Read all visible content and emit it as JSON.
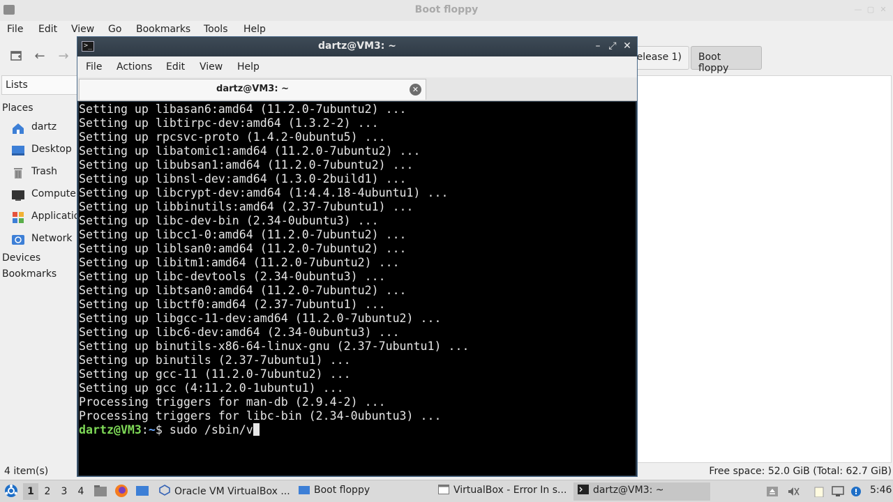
{
  "file_manager": {
    "window_title": "Boot floppy",
    "menu": [
      "File",
      "Edit",
      "View",
      "Go",
      "Bookmarks",
      "Tools",
      "Help"
    ],
    "tabs": [
      {
        "label": "elease 1)"
      },
      {
        "label": "Boot floppy"
      }
    ],
    "sidebar": {
      "lists_label": "Lists",
      "places_label": "Places",
      "items": [
        {
          "label": "dartz",
          "icon": "home-icon"
        },
        {
          "label": "Desktop",
          "icon": "desktop-icon"
        },
        {
          "label": "Trash",
          "icon": "trash-icon"
        },
        {
          "label": "Computer",
          "icon": "computer-icon"
        },
        {
          "label": "Applications",
          "icon": "applications-icon"
        },
        {
          "label": "Network",
          "icon": "network-icon"
        }
      ],
      "devices_label": "Devices",
      "bookmarks_label": "Bookmarks"
    },
    "status_left": "4 item(s)",
    "status_right": "Free space: 52.0 GiB (Total: 62.7 GiB)"
  },
  "terminal": {
    "window_title": "dartz@VM3: ~",
    "menu": [
      "File",
      "Actions",
      "Edit",
      "View",
      "Help"
    ],
    "tab_label": "dartz@VM3: ~",
    "lines": [
      "Setting up libasan6:amd64 (11.2.0-7ubuntu2) ...",
      "Setting up libtirpc-dev:amd64 (1.3.2-2) ...",
      "Setting up rpcsvc-proto (1.4.2-0ubuntu5) ...",
      "Setting up libatomic1:amd64 (11.2.0-7ubuntu2) ...",
      "Setting up libubsan1:amd64 (11.2.0-7ubuntu2) ...",
      "Setting up libnsl-dev:amd64 (1.3.0-2build1) ...",
      "Setting up libcrypt-dev:amd64 (1:4.4.18-4ubuntu1) ...",
      "Setting up libbinutils:amd64 (2.37-7ubuntu1) ...",
      "Setting up libc-dev-bin (2.34-0ubuntu3) ...",
      "Setting up libcc1-0:amd64 (11.2.0-7ubuntu2) ...",
      "Setting up liblsan0:amd64 (11.2.0-7ubuntu2) ...",
      "Setting up libitm1:amd64 (11.2.0-7ubuntu2) ...",
      "Setting up libc-devtools (2.34-0ubuntu3) ...",
      "Setting up libtsan0:amd64 (11.2.0-7ubuntu2) ...",
      "Setting up libctf0:amd64 (2.37-7ubuntu1) ...",
      "Setting up libgcc-11-dev:amd64 (11.2.0-7ubuntu2) ...",
      "Setting up libc6-dev:amd64 (2.34-0ubuntu3) ...",
      "Setting up binutils-x86-64-linux-gnu (2.37-7ubuntu1) ...",
      "Setting up binutils (2.37-7ubuntu1) ...",
      "Setting up gcc-11 (11.2.0-7ubuntu2) ...",
      "Setting up gcc (4:11.2.0-1ubuntu1) ...",
      "Processing triggers for man-db (2.9.4-2) ...",
      "Processing triggers for libc-bin (2.34-0ubuntu3) ..."
    ],
    "prompt_user": "dartz@VM3",
    "prompt_sep": ":",
    "prompt_path": "~",
    "prompt_symbol": "$ ",
    "command": "sudo /sbin/v"
  },
  "taskbar": {
    "workspaces": [
      "1",
      "2",
      "3",
      "4"
    ],
    "active_workspace": "1",
    "tasks": [
      {
        "label": "Oracle VM VirtualBox ...",
        "icon": "virtualbox-icon"
      },
      {
        "label": "Boot floppy",
        "icon": "folder-icon"
      },
      {
        "label": "VirtualBox - Error In s...",
        "icon": "window-icon"
      },
      {
        "label": "dartz@VM3: ~",
        "icon": "terminal-icon"
      }
    ],
    "clock": "5:46"
  },
  "colors": {
    "terminal_bg": "#000000",
    "prompt_user": "#7ed957",
    "prompt_path": "#6aa8ff"
  }
}
